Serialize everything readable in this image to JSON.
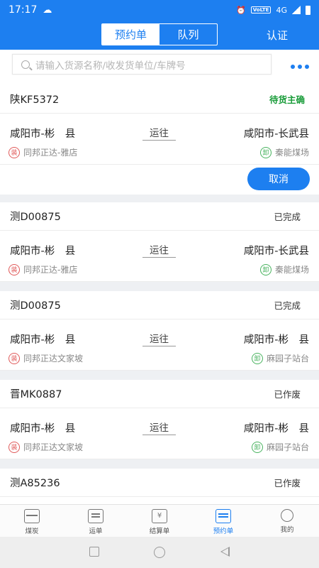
{
  "status_bar": {
    "time": "17:17",
    "volte": "VoLTE",
    "net": "4G"
  },
  "header": {
    "tabs": [
      {
        "label": "预约单",
        "active": true
      },
      {
        "label": "队列",
        "active": false
      }
    ],
    "right_action": "认证"
  },
  "search": {
    "placeholder": "请输入货源名称/收发货单位/车牌号"
  },
  "cards": [
    {
      "plate": "陕KF5372",
      "status": "待货主确",
      "from": "咸阳市-彬　县",
      "via": "运往",
      "to": "咸阳市-长武县",
      "shipper_badge": "装",
      "shipper": "同邦正达-雅店",
      "consignee_badge": "卸",
      "consignee": "秦能煤场",
      "action": "取消"
    },
    {
      "plate": "测D00875",
      "status": "已完成",
      "from": "咸阳市-彬　县",
      "via": "运往",
      "to": "咸阳市-长武县",
      "shipper_badge": "装",
      "shipper": "同邦正达-雅店",
      "consignee_badge": "卸",
      "consignee": "秦能煤场"
    },
    {
      "plate": "测D00875",
      "status": "已完成",
      "from": "咸阳市-彬　县",
      "via": "运往",
      "to": "咸阳市-彬　县",
      "shipper_badge": "装",
      "shipper": "同邦正达文家坡",
      "consignee_badge": "卸",
      "consignee": "麻园子站台"
    },
    {
      "plate": "晋MK0887",
      "status": "已作废",
      "from": "咸阳市-彬　县",
      "via": "运往",
      "to": "咸阳市-彬　县",
      "shipper_badge": "装",
      "shipper": "同邦正达文家坡",
      "consignee_badge": "卸",
      "consignee": "麻园子站台"
    },
    {
      "plate": "测A85236",
      "status": "已作废"
    }
  ],
  "tabbar": [
    {
      "label": "煤炭",
      "icon": "truck-icon"
    },
    {
      "label": "运单",
      "icon": "waybill-icon"
    },
    {
      "label": "结算单",
      "icon": "settlement-icon"
    },
    {
      "label": "预约单",
      "icon": "reservation-icon",
      "active": true
    },
    {
      "label": "我的",
      "icon": "profile-icon"
    }
  ],
  "colors": {
    "primary": "#1d7ff0",
    "pending": "#1a9c3a",
    "load_badge": "#e05a5a",
    "unload_badge": "#49b35f"
  }
}
